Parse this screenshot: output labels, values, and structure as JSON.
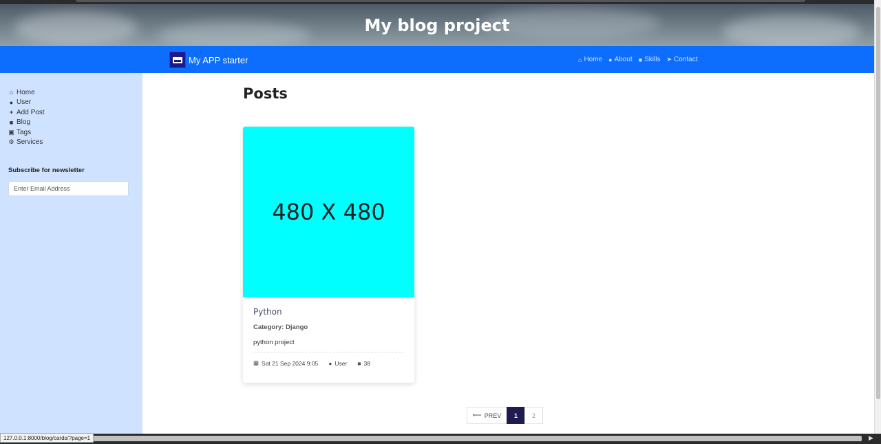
{
  "hero": {
    "title": "My blog project"
  },
  "navbar": {
    "brand": "My APP starter",
    "links": [
      {
        "label": "Home",
        "icon": "home-icon"
      },
      {
        "label": "About",
        "icon": "user-icon"
      },
      {
        "label": "Skills",
        "icon": "book-icon"
      },
      {
        "label": "Contact",
        "icon": "send-icon"
      }
    ]
  },
  "sidebar": {
    "items": [
      {
        "label": "Home",
        "icon": "home-icon"
      },
      {
        "label": "User",
        "icon": "user-icon"
      },
      {
        "label": "Add Post",
        "icon": "plus-icon"
      },
      {
        "label": "Blog",
        "icon": "book-icon"
      },
      {
        "label": "Tags",
        "icon": "briefcase-icon"
      },
      {
        "label": "Services",
        "icon": "cogs-icon"
      }
    ],
    "newsletter_title": "Subscribe for newsletter",
    "email_placeholder": "Enter Email Address"
  },
  "main": {
    "title": "Posts",
    "posts": [
      {
        "image_text": "480 X 480",
        "title": "Python",
        "category": "Category: Django",
        "description": "python project",
        "date": "Sat 21 Sep 2024 9:05",
        "author": "User",
        "comments": "38"
      }
    ]
  },
  "pagination": {
    "prev_label": "PREV",
    "pages": [
      "1",
      "2"
    ],
    "current": "1"
  },
  "status_bar": {
    "url": "127.0.0.1:8000/blog/cards/?page=1"
  },
  "colors": {
    "navbar": "#0d6efd",
    "sidebar": "#cfe2ff",
    "card_image": "#00ffff",
    "page_active": "#1d1b4f"
  }
}
